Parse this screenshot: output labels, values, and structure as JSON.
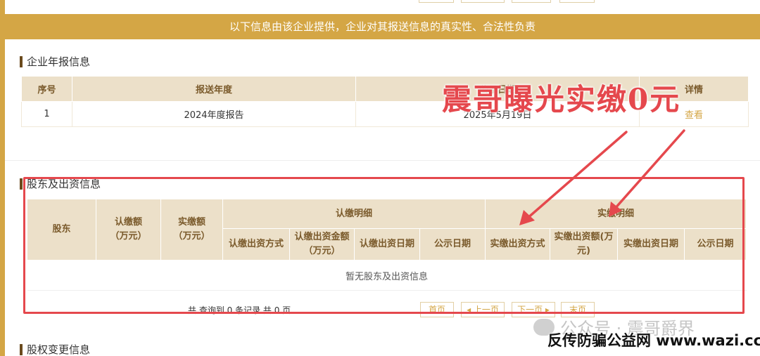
{
  "notice": "以下信息由该企业提供，企业对其报送信息的真实性、合法性负责",
  "annual_report": {
    "title": "企业年报信息",
    "headers": [
      "序号",
      "报送年度",
      "公示日期",
      "详情"
    ],
    "rows": [
      {
        "no": "1",
        "year": "2024年度报告",
        "date": "2025年5月19日",
        "action": "查看"
      }
    ]
  },
  "shareholders": {
    "title": "股东及出资信息",
    "h_shareholder": "股东",
    "h_subscribed": "认缴额\n（万元）",
    "h_paid": "实缴额\n（万元）",
    "h_sub_detail": "认缴明细",
    "h_paid_detail": "实缴明细",
    "sub_cols": [
      "认缴出资方式",
      "认缴出资金额\n（万元）",
      "认缴出资日期",
      "公示日期"
    ],
    "paid_cols": [
      "实缴出资方式",
      "实缴出资额(万\n元)",
      "实缴出资日期",
      "公示日期"
    ],
    "empty_text": "暂无股东及出资信息",
    "pager_info": "共 查询到 0 条记录 共 0 页",
    "pager": {
      "first": "首页",
      "prev": "上一页",
      "next": "下一页",
      "last": "末页"
    }
  },
  "equity_change": {
    "title": "股权变更信息"
  },
  "overlay": {
    "title": "震哥曝光实缴0元"
  },
  "watermark": {
    "account": "公众号 · 震哥爵界",
    "site": "反传防骗公益网 www.wazi.cc"
  },
  "colors": {
    "accent": "#d4a645",
    "header_bg": "#ece0c9",
    "header_text": "#7a5a2b",
    "highlight_red": "#e5484d"
  }
}
